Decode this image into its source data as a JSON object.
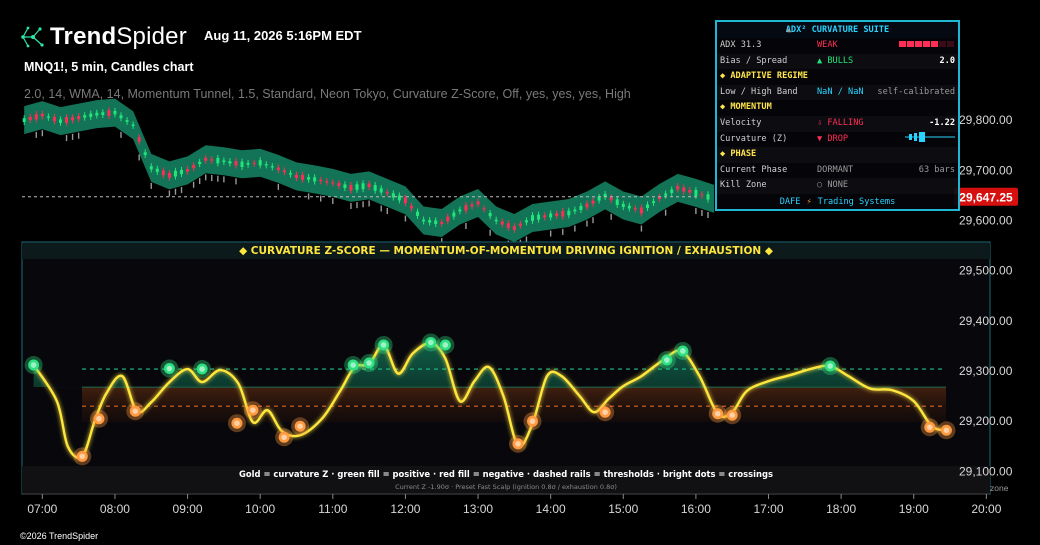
{
  "header": {
    "brand_bold": "Trend",
    "brand_light": "Spider",
    "timestamp": "Aug 11, 2026 5:16PM EDT",
    "symbol_line": "MNQ1!, 5 min, Candles chart",
    "indicator_line": "                       2.0, 14, WMA, 14, Momentum Tunnel, 1.5, Standard, Neon Tokyo, Curvature Z-Score, Off, yes, yes, yes, High"
  },
  "colors": {
    "bull": "#22e67a",
    "bear": "#ff2d55",
    "tunnel": "#15805f",
    "gold": "#ffe63d",
    "dot": "#ff9a40",
    "price_label_bg": "#d60f0f",
    "hud_border": "#1fb7d4"
  },
  "price_axis": {
    "current_price": "29,647.25"
  },
  "chart_data": {
    "type": "line",
    "title": "◆ CURVATURE Z-SCORE — MOMENTUM-OF-MOMENTUM DRIVING IGNITION / EXHAUSTION ◆",
    "legend_text": "Gold = curvature Z · green fill = positive · red fill = negative · dashed rails = thresholds · bright dots = crossings",
    "status_text": "Current Z -1.90σ · Preset Fast Scalp (ignition 0.8σ / exhaustion 0.8σ)",
    "axis_suffix": "zone",
    "x_ticks": [
      "07:00",
      "08:00",
      "09:00",
      "10:00",
      "11:00",
      "12:00",
      "13:00",
      "14:00",
      "15:00",
      "16:00",
      "17:00",
      "18:00",
      "19:00",
      "20:00"
    ],
    "y_ticks": [
      "29,800.00",
      "29,700.00",
      "29,600.00",
      "29,500.00",
      "29,400.00",
      "29,300.00",
      "29,200.00",
      "29,100.00"
    ],
    "ylim": [
      29055,
      29880
    ],
    "xlim_hours": [
      6.72,
      20.05
    ],
    "price_series": {
      "name": "MNQ1!",
      "x": [
        6.75,
        7.0,
        7.25,
        7.5,
        7.75,
        8.0,
        8.25,
        8.5,
        8.75,
        9.0,
        9.25,
        9.5,
        9.75,
        10.0,
        10.25,
        10.5,
        10.75,
        11.0,
        11.25,
        11.5,
        11.75,
        12.0,
        12.25,
        12.5,
        12.75,
        13.0,
        13.25,
        13.5,
        13.75,
        14.0,
        14.25,
        14.5,
        14.75,
        15.0,
        15.25,
        15.5,
        15.75,
        16.0,
        16.25
      ],
      "values": [
        29800,
        29810,
        29798,
        29805,
        29812,
        29815,
        29790,
        29705,
        29690,
        29700,
        29722,
        29718,
        29712,
        29715,
        29703,
        29688,
        29682,
        29675,
        29665,
        29670,
        29655,
        29640,
        29600,
        29595,
        29620,
        29635,
        29600,
        29585,
        29605,
        29610,
        29615,
        29630,
        29650,
        29630,
        29620,
        29645,
        29665,
        29655,
        29643
      ]
    },
    "curvature_series": {
      "name": "Curvature Z",
      "x": [
        6.88,
        7.2,
        7.35,
        7.55,
        7.72,
        7.88,
        8.1,
        8.3,
        8.5,
        8.75,
        9.0,
        9.2,
        9.45,
        9.7,
        9.9,
        10.1,
        10.3,
        10.55,
        10.85,
        11.1,
        11.3,
        11.5,
        11.7,
        11.9,
        12.1,
        12.35,
        12.55,
        12.75,
        12.95,
        13.15,
        13.35,
        13.55,
        13.75,
        13.95,
        14.15,
        14.4,
        14.6,
        14.8,
        15.0,
        15.25,
        15.55,
        15.8,
        16.05,
        16.3,
        16.5,
        16.7,
        17.0,
        17.3,
        17.6,
        17.85,
        18.1,
        18.4,
        18.7,
        19.0,
        19.25,
        19.45
      ],
      "values": [
        29312,
        29240,
        29150,
        29130,
        29200,
        29255,
        29290,
        29220,
        29238,
        29278,
        29304,
        29278,
        29302,
        29275,
        29198,
        29222,
        29180,
        29172,
        29205,
        29260,
        29308,
        29314,
        29352,
        29295,
        29335,
        29356,
        29325,
        29240,
        29280,
        29308,
        29250,
        29152,
        29195,
        29290,
        29290,
        29250,
        29218,
        29245,
        29270,
        29290,
        29322,
        29340,
        29290,
        29215,
        29218,
        29260,
        29280,
        29292,
        29305,
        29310,
        29290,
        29265,
        29262,
        29240,
        29190,
        29182
      ],
      "crossing_points": [
        {
          "x": 6.88,
          "value": 29312,
          "kind": "bull"
        },
        {
          "x": 7.55,
          "value": 29130,
          "kind": "bear"
        },
        {
          "x": 7.78,
          "value": 29205,
          "kind": "bear"
        },
        {
          "x": 8.28,
          "value": 29220,
          "kind": "bear"
        },
        {
          "x": 8.75,
          "value": 29305,
          "kind": "bull"
        },
        {
          "x": 9.2,
          "value": 29304,
          "kind": "bull"
        },
        {
          "x": 9.68,
          "value": 29196,
          "kind": "bear"
        },
        {
          "x": 9.9,
          "value": 29222,
          "kind": "bear"
        },
        {
          "x": 10.33,
          "value": 29168,
          "kind": "bear"
        },
        {
          "x": 10.55,
          "value": 29190,
          "kind": "bear"
        },
        {
          "x": 11.28,
          "value": 29312,
          "kind": "bull"
        },
        {
          "x": 11.5,
          "value": 29316,
          "kind": "bull"
        },
        {
          "x": 11.7,
          "value": 29352,
          "kind": "bull"
        },
        {
          "x": 12.35,
          "value": 29357,
          "kind": "bull"
        },
        {
          "x": 12.55,
          "value": 29352,
          "kind": "bull"
        },
        {
          "x": 13.55,
          "value": 29155,
          "kind": "bear"
        },
        {
          "x": 13.75,
          "value": 29200,
          "kind": "bear"
        },
        {
          "x": 14.75,
          "value": 29218,
          "kind": "bear"
        },
        {
          "x": 15.6,
          "value": 29322,
          "kind": "bull"
        },
        {
          "x": 15.82,
          "value": 29340,
          "kind": "bull"
        },
        {
          "x": 16.3,
          "value": 29215,
          "kind": "bear"
        },
        {
          "x": 16.5,
          "value": 29212,
          "kind": "bear"
        },
        {
          "x": 17.85,
          "value": 29310,
          "kind": "bull"
        },
        {
          "x": 19.22,
          "value": 29188,
          "kind": "bear"
        },
        {
          "x": 19.45,
          "value": 29182,
          "kind": "bear"
        }
      ]
    },
    "thresholds": {
      "upper": 29304,
      "lower": 29230,
      "zero": 29268
    },
    "grid": false,
    "legend_position": "bottom"
  },
  "hud": {
    "title": "ADX² CURVATURE SUITE",
    "title_icon": "◣",
    "rows": [
      {
        "k": "ADX 31.3",
        "m": "WEAK",
        "v": "meter",
        "cls": "red"
      },
      {
        "k": "Bias / Spread",
        "m": "▲ BULLS",
        "v": "2.0",
        "cls": "green"
      },
      {
        "section": "◆ ADAPTIVE REGIME"
      },
      {
        "k": "Low / High Band",
        "m": "NaN / NaN",
        "v": "self-calibrated",
        "cls": "cyan"
      },
      {
        "section": "◆ MOMENTUM"
      },
      {
        "k": "Velocity",
        "m": "⇩ FALLING",
        "v": "-1.22",
        "cls": "red"
      },
      {
        "k": "Curvature (Z)",
        "m": "▼ DROP",
        "v": "gauge",
        "cls": "red"
      },
      {
        "section": "◆ PHASE"
      },
      {
        "k": "Current Phase",
        "m": "DORMANT",
        "v": "63 bars",
        "cls": "grey"
      },
      {
        "k": "Kill Zone",
        "m": "○ NONE",
        "v": "",
        "cls": "grey"
      }
    ],
    "footer_left": "DAFE",
    "footer_amp": "⚡",
    "footer_right": "Trading Systems"
  },
  "footer": {
    "copyright": "©2026 TrendSpider"
  }
}
